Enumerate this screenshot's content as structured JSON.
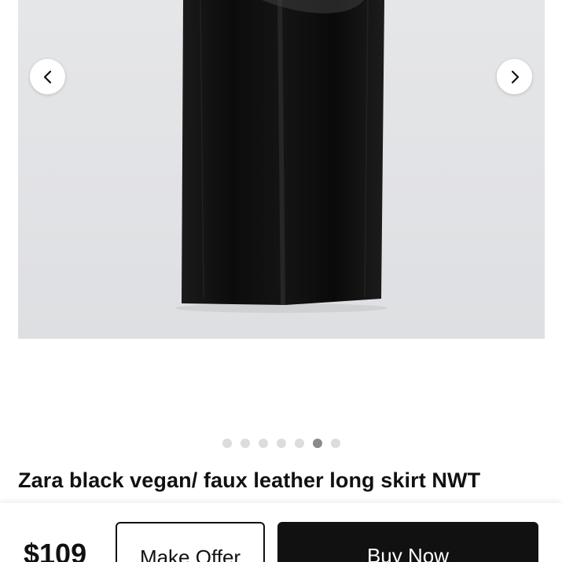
{
  "listing": {
    "title": "Zara black vegan/ faux leather long skirt NWT",
    "price": "$109"
  },
  "carousel": {
    "total_images": 7,
    "active_index": 5,
    "prev_icon": "chevron-left-icon",
    "next_icon": "chevron-right-icon"
  },
  "actions": {
    "make_offer_label": "Make Offer",
    "buy_now_label": "Buy Now"
  },
  "colors": {
    "primary_button": "#111111",
    "dot_active": "#8a8a8a",
    "dot_inactive": "#dcdcdc"
  }
}
